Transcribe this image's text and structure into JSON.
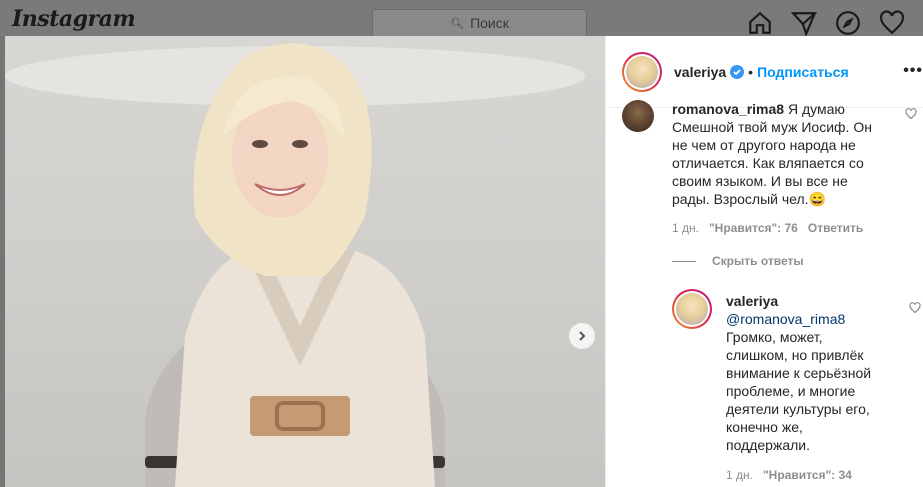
{
  "topbar": {
    "logo": "Instagram",
    "search_placeholder": "Поиск",
    "icons": [
      "home-icon",
      "direct-icon",
      "explore-icon",
      "activity-icon"
    ]
  },
  "post": {
    "author": "valeriya",
    "separator": "•",
    "follow_label": "Подписаться",
    "more_label": "•••"
  },
  "comments": [
    {
      "user": "romanova_rima8",
      "text": " Я думаю Смешной твой муж Иосиф. Он не чем от другого народа не отличается. Как вляпается со своим языком. И вы все не рады. Взрослый чел.😄",
      "time": "1 дн.",
      "likes": "\"Нравится\": 76",
      "reply_label": "Ответить"
    }
  ],
  "hide_replies_label": "Скрыть ответы",
  "reply": {
    "user": "valeriya",
    "mention": "@romanova_rima8",
    "text": "Громко, может, слишком, но привлёк внимание к серьёзной проблеме, и многие деятели культуры его, конечно же, поддержали.",
    "time": "1 дн.",
    "likes": "\"Нравится\": 34"
  },
  "colors": {
    "accent": "#0095f6",
    "mention": "#00376b",
    "overlay": "#757575"
  }
}
